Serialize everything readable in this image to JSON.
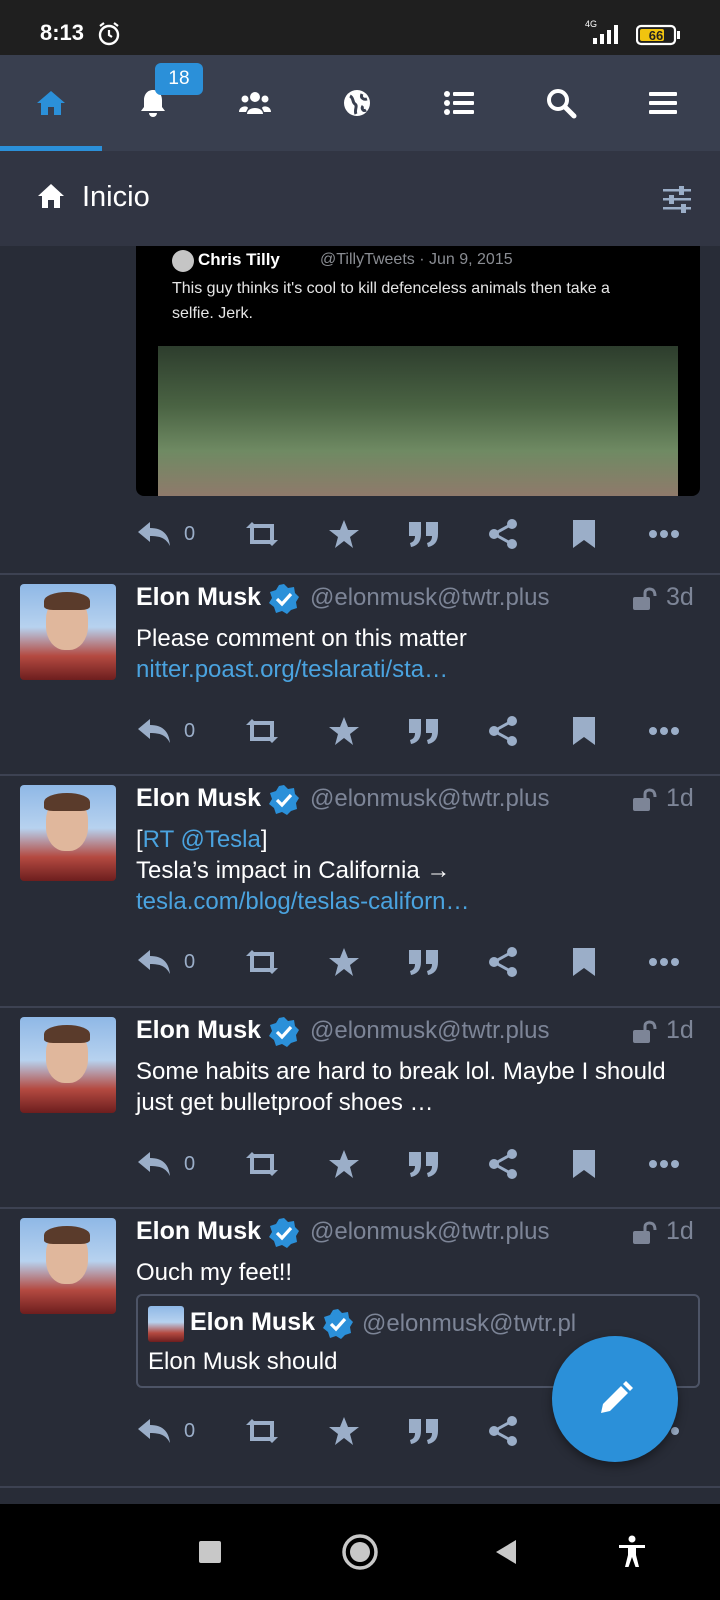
{
  "statusbar": {
    "time": "8:13",
    "network": "4G",
    "battery": "66"
  },
  "nav": {
    "badge": "18",
    "items": [
      "home",
      "notifications",
      "communities",
      "federated",
      "lists",
      "search",
      "menu"
    ]
  },
  "column": {
    "title": "Inicio"
  },
  "media_card": {
    "author": "Chris Tilly",
    "handle": "@TillyTweets · Jun 9, 2015",
    "text": "This guy thinks it's cool to kill defenceless animals then take a selfie. Jerk."
  },
  "statuses": [
    {
      "reply_count": "0"
    },
    {
      "author": "Elon Musk",
      "handle": "@elonmusk@twtr.plus",
      "time": "3d",
      "text": "Please comment on this matter",
      "link": "nitter.poast.org/teslarati/sta…",
      "reply_count": "0"
    },
    {
      "author": "Elon Musk",
      "handle": "@elonmusk@twtr.plus",
      "time": "1d",
      "rt_prefix": "[",
      "rt_link": "RT @Tesla",
      "rt_suffix": "]",
      "text": "Tesla’s impact in California →",
      "link": "tesla.com/blog/teslas-californ…",
      "reply_count": "0"
    },
    {
      "author": "Elon Musk",
      "handle": "@elonmusk@twtr.plus",
      "time": "1d",
      "text": "Some habits are hard to break lol.  Maybe I should just get bulletproof shoes …",
      "reply_count": "0"
    },
    {
      "author": "Elon Musk",
      "handle": "@elonmusk@twtr.plus",
      "time": "1d",
      "text": "Ouch my feet!!",
      "quote": {
        "author": "Elon Musk",
        "handle": "@elonmusk@twtr.pl",
        "text": "Elon Musk should"
      },
      "reply_count": "0"
    }
  ],
  "colors": {
    "accent": "#2b90d9",
    "background": "#282c37",
    "header": "#393f4f",
    "muted": "#7d8597"
  }
}
